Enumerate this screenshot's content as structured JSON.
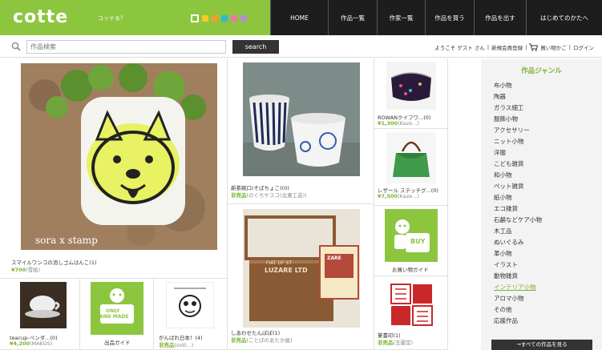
{
  "header": {
    "logo": "cotte",
    "tagline": "コッテる？",
    "swatch_colors": [
      "#8cc63f",
      "#f7c927",
      "#f29b30",
      "#35b7d0",
      "#e879a5",
      "#b48fd0"
    ],
    "nav": [
      "HOME",
      "作品一覧",
      "作家一覧",
      "作品を買う",
      "作品を出す",
      "はじめてのかたへ"
    ]
  },
  "search": {
    "placeholder": "作品検索",
    "button": "search"
  },
  "user": {
    "greeting": "ようこそ ゲスト さん",
    "sep1": "|",
    "register": "新規会員登録",
    "sep2": "|",
    "cart": "買い物かご",
    "sep3": "|",
    "login": "ログイン"
  },
  "items": {
    "stamp": {
      "caption": "スマイルワンコの消しゴムはんこ(1)",
      "price": "¥700",
      "who": "(雪絵)"
    },
    "teacup": {
      "caption": "teacup-ペンダ...(0)",
      "price": "¥4,200",
      "who": "(MAKOS)"
    },
    "handmade": {
      "badge_top": "ONLY",
      "badge_bottom": "HAND MADE",
      "caption": "出品ガイド"
    },
    "robot": {
      "caption": "がんばれ日本！(4)",
      "price": "非売品",
      "who": "(sott...)"
    },
    "cups": {
      "caption": "新茶碗口(そばちょこ)(0)",
      "price": "非売品",
      "who": "(のぐちヤスコ(北東工芸))"
    },
    "box": {
      "caption": "しあわせたんぽぽ(1)",
      "price": "非売品",
      "who": "(ことばのあたか屋)"
    },
    "book_title": "LUZARE LTD",
    "book_sub": "FIAT OF ST",
    "book_cover": "ZARE",
    "pouch": {
      "caption": "ROWANクイフワ...(0)",
      "price": "¥1,300",
      "who": "(Kaze...)"
    },
    "bag": {
      "caption": "レザール ステッチグ...(0)",
      "price": "¥7,500",
      "who": "(Kaze...)"
    },
    "buy": {
      "badge": "BUY",
      "caption": "お買い物ガイド"
    },
    "seal": {
      "caption": "篆書印(1)",
      "price": "非売品",
      "who": "(玉蘭堂)"
    }
  },
  "sidebar": {
    "title": "作品ジャンル",
    "genres": [
      "布小物",
      "陶器",
      "ガラス細工",
      "服飾小物",
      "アクセサリー",
      "ニット小物",
      "洋服",
      "こども雑貨",
      "和小物",
      "ペット雑貨",
      "紙小物",
      "エコ雑貨",
      "石鹸などケア小物",
      "木工品",
      "ぬいぐるみ",
      "革小物",
      "イラスト",
      "動物雑貨",
      "インテリア小物",
      "アロマ小物",
      "その他",
      "応援作品"
    ],
    "active": "インテリア小物",
    "all_button": "→すべての作品を見る"
  }
}
